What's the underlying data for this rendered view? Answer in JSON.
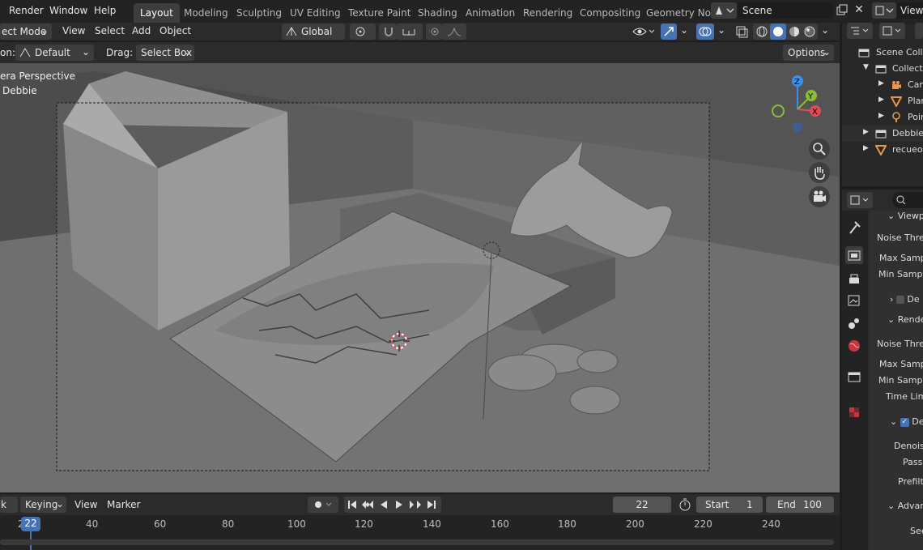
{
  "topbar": {
    "menus": [
      "Render",
      "Window",
      "Help"
    ],
    "workspaces": [
      "Layout",
      "Modeling",
      "Sculpting",
      "UV Editing",
      "Texture Paint",
      "Shading",
      "Animation",
      "Rendering",
      "Compositing",
      "Geometry Noc"
    ],
    "active_workspace": "Layout",
    "scene_name": "Scene",
    "view_layer": "View"
  },
  "viewport_header": {
    "mode": "ect Mode",
    "menus": [
      "View",
      "Select",
      "Add",
      "Object"
    ],
    "orientation": "Global"
  },
  "tool_settings": {
    "orientation_label": "on:",
    "orientation_value": "Default",
    "drag_label": "Drag:",
    "drag_value": "Select Box",
    "options_label": "Options"
  },
  "viewport": {
    "view_name": "era Perspective",
    "object_name": "Debbie"
  },
  "timeline": {
    "playback_label": "k",
    "keying_label": "Keying",
    "view_label": "View",
    "marker_label": "Marker",
    "current_frame": "22",
    "start_label": "Start",
    "start_value": "1",
    "end_label": "End",
    "end_value": "100",
    "ruler_marks": [
      "2",
      "40",
      "60",
      "80",
      "100",
      "120",
      "140",
      "160",
      "180",
      "200",
      "220",
      "240"
    ],
    "playhead": "22"
  },
  "outliner": {
    "items": [
      {
        "label": "Scene Colle",
        "icon": "scene-collection-icon"
      },
      {
        "label": "Collecti",
        "icon": "collection-icon"
      },
      {
        "label": "Can",
        "icon": "camera-icon"
      },
      {
        "label": "Plar",
        "icon": "mesh-icon"
      },
      {
        "label": "Poir",
        "icon": "light-icon"
      },
      {
        "label": "Debbie",
        "icon": "collection-icon"
      },
      {
        "label": "recueob",
        "icon": "mesh-icon"
      }
    ]
  },
  "properties": {
    "rows": [
      "Viewp",
      "Noise Thres",
      "Max Sampl",
      "Min Sample",
      "De",
      "Rende",
      "Noise Thres",
      "Max Sampl",
      "Min Sampl",
      "Time Lim",
      "De",
      "Denoise",
      "Passe",
      "Prefilte",
      "Advan",
      "See"
    ]
  },
  "colors": {
    "accent_blue": "#4772b3",
    "axis_x": "#e34a56",
    "axis_y": "#8bbd36",
    "axis_z": "#3d8eea"
  }
}
